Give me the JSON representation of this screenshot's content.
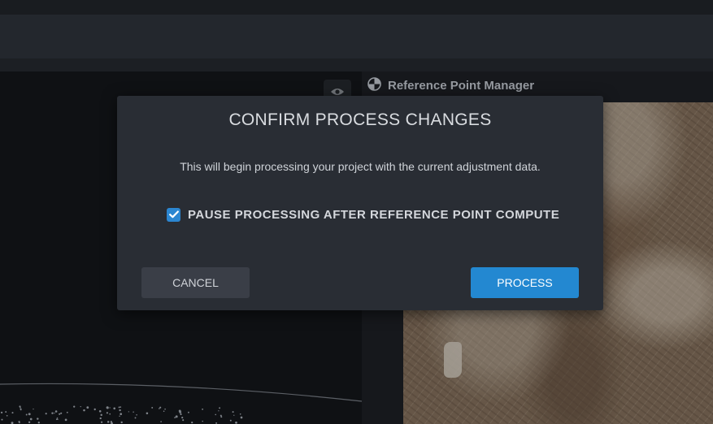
{
  "background": {
    "panel_title": "Reference Point Manager",
    "panel_icon": "reference-point-icon",
    "visibility_icon": "eye-icon"
  },
  "dialog": {
    "title": "CONFIRM PROCESS CHANGES",
    "message": "This will begin processing your project with the current adjustment data.",
    "checkbox": {
      "label": "PAUSE PROCESSING AFTER REFERENCE POINT COMPUTE",
      "checked": true,
      "icon": "checkmark-icon"
    },
    "cancel_label": "CANCEL",
    "process_label": "PROCESS"
  },
  "colors": {
    "accent": "#2388d1",
    "dialog_bg": "#292d34",
    "cancel_bg": "#3a3e47"
  }
}
